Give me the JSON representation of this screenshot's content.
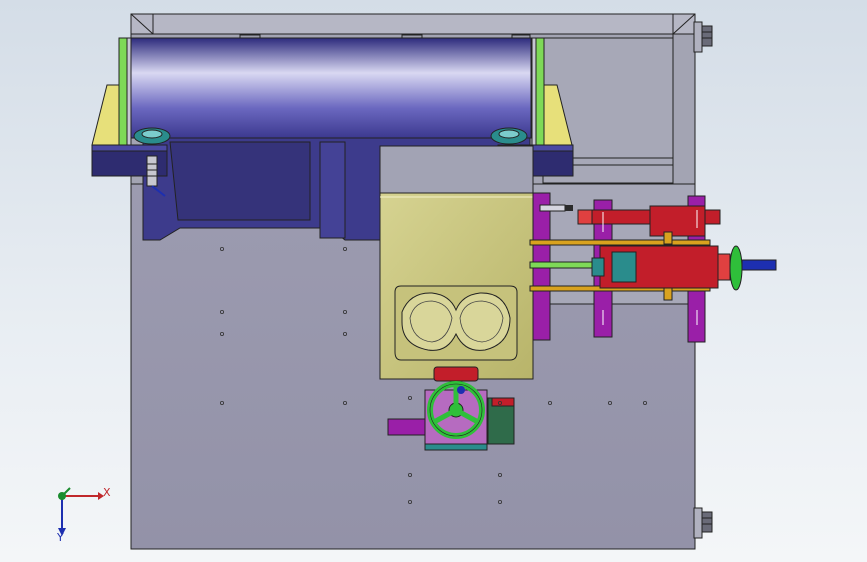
{
  "viewport": {
    "title": "",
    "background": "#e6ebf0"
  },
  "triad": {
    "x_label": "X",
    "y_label": "Y",
    "x_color": "#c0282b",
    "y_color": "#1d2fb0",
    "z_color": "#1a8c2e"
  },
  "model": {
    "frame_color": "#8a8d98",
    "plate_color": "#9b9aae",
    "roller_color": "#4a47a8",
    "cover_color": "#c9c57a",
    "cylinder_color": "#c21e2a",
    "bracket_color": "#9a1fa8",
    "wheel_color": "#2fbf3a",
    "guide_rail_color": "#d9a21e",
    "side_panel_color": "#e7e07a",
    "accent_green": "#7ed957",
    "motor_color": "#2a8c8c"
  }
}
